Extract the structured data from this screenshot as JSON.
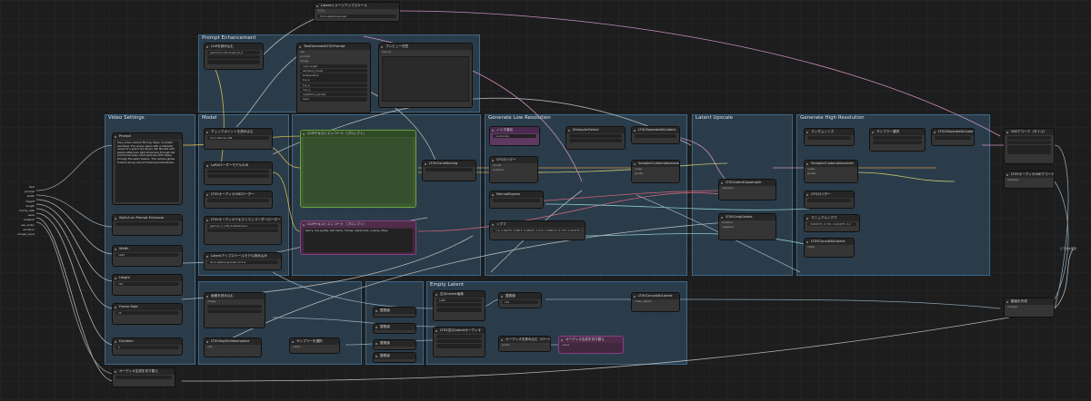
{
  "app": {
    "name": "ComfyUI workflow canvas"
  },
  "groups": [
    {
      "id": "prompt-enh",
      "title": "Prompt Enhancement"
    },
    {
      "id": "video-settings",
      "title": "Video Settings"
    },
    {
      "id": "model",
      "title": "Model"
    },
    {
      "id": "prompt",
      "title": ""
    },
    {
      "id": "gen-low",
      "title": "Generate Low Resolution"
    },
    {
      "id": "latent-upscale",
      "title": "Latent Upscale"
    },
    {
      "id": "gen-high",
      "title": "Generate High Resolution"
    },
    {
      "id": "bottom-left",
      "title": ""
    },
    {
      "id": "bottom-mid",
      "title": ""
    },
    {
      "id": "empty-latent",
      "title": "Empty Latent"
    }
  ],
  "nodes": {
    "latent_top": {
      "title": "Latentイメージアップスケール",
      "rows": [
        "モデル",
        "アップスケール"
      ],
      "widget": "ltx-2-spatial-upscaler"
    },
    "load_llm": {
      "title": "LLMを読み込む",
      "widget": "gemma-3-12b-it-qat-q4_0"
    },
    "enh_gen": {
      "title": "TextGenerateLTX2Prompt",
      "rows": [
        "clip",
        "prompt",
        "image",
        "max_length",
        "sampling_mode",
        "temperature",
        "top_k",
        "top_p",
        "min_p",
        "repetition_penalty",
        "seed"
      ]
    },
    "preview_text": {
      "title": "プレビュー任意",
      "rows": [
        "source"
      ]
    },
    "prompt": {
      "title": "Prompt",
      "text": "Sony video camera filming, Style: cinematic handheld. The scene opens with a dramatic reveal of a grand old library hall flooded with golden afternoon light streaming through tall arched windows. Dust particles drift slowly through the warm beams. The camera glides forward along rows of towering bookshelves."
    },
    "enhancer_toggle": {
      "title": "Switch on Prompt Enhancer"
    },
    "width": {
      "title": "Width",
      "value": "1280"
    },
    "height": {
      "title": "Height",
      "value": "720"
    },
    "frame_rate": {
      "title": "Frame Rate",
      "value": "25"
    },
    "duration": {
      "title": "Duration",
      "value": "5"
    },
    "checkpoint_loader": {
      "title": "チェックポイントを読み込む",
      "widget": "ltx-2-19b-dev-fp8"
    },
    "lora_loader": {
      "title": "LoRAローダーモデルのみ"
    },
    "lora_loader2": {
      "title": "LTXVオーディオVAEローダー"
    },
    "text_encoder": {
      "title": "LTXVオーディオテキストエンコーダーローダー",
      "widget": "gemma_3_12B_it.safetensors"
    },
    "latent_up2": {
      "title": "Latentアップスケールモデル読み込み",
      "widget": "ltx-2-spatial-upscaler-x2-1.0"
    },
    "clip_pos": {
      "title": "CLIPテキストエンコード（プロンプト）"
    },
    "clip_neg": {
      "title": "CLIPテキストエンコード（プロンプト）",
      "text": "blurry, low quality, still frame, frames, watermark, overlay, titles"
    },
    "ltxv_cond": {
      "title": "LTXVConditioning"
    },
    "mgr": {
      "title": "モデル"
    },
    "low_noise": {
      "title": "ノイズ追加",
      "widget": "randomize"
    },
    "low_sampler": {
      "title": "KSamplerSelect"
    },
    "low_cfg": {
      "title": "CFGガイダー"
    },
    "low_sched": {
      "title": "ManualSigmas"
    },
    "low_sigmas": {
      "title": "シグマ",
      "widget": "1.0, 0.99375, 0.9875, 0.98125, 0.975, 0.909375, 0.725, 0.421875, 0.0"
    },
    "low_adv": {
      "title": "SamplerCustomAdvanced"
    },
    "low_sep": {
      "title": "LTXVSeparateAVLatent"
    },
    "low_cat": {
      "title": "LTXVConcatAVLatent"
    },
    "up_node": {
      "title": "LTXVLatentUpsampler"
    },
    "up_crop": {
      "title": "LTXVCropGuides"
    },
    "hi_noise": {
      "title": "ランダムノイズ"
    },
    "hi_sampler": {
      "title": "サンプラー選択"
    },
    "hi_sigmas": {
      "title": "マニュアルシグマ",
      "widget": "0.909375, 0.725, 0.421875, 0.0"
    },
    "hi_adv": {
      "title": "SamplerCustomAdvanced"
    },
    "hi_sep": {
      "title": "LTXVSeparateAVLatent"
    },
    "hi_vae": {
      "title": "VAEデコード（タイル）"
    },
    "audio_vae": {
      "title": "LTXVオーディオVAEデコード"
    },
    "create_video": {
      "title": "動画を作成"
    },
    "empty_img": {
      "title": "空のLatent画像",
      "widget": "1280"
    },
    "empty_audio": {
      "title": "LTXV空のLatentオーディオ"
    },
    "concat_av": {
      "title": "LTXVConcatAVLatent"
    },
    "img_to_video": {
      "title": "LTXVImgToVideoInplace"
    },
    "set_node": {
      "title": "サンプラーを選択"
    },
    "math": {
      "title": "整数値",
      "widget": "121"
    },
    "load_audio": {
      "title": "オーディオを読み込む（ロード）"
    },
    "save_video": {
      "title": "ビデオを保存"
    },
    "bottom_toggle": {
      "title": "オーディオ生成を切り替え"
    },
    "image_in": {
      "title": "画像を読み込む",
      "rows": [
        "image"
      ]
    }
  },
  "primitive_inputs": [
    "text",
    "prompt",
    "width",
    "height",
    "length",
    "frame_rate",
    "seed",
    "enabled",
    "use_audio",
    "duration",
    "image_input"
  ],
  "colors": {
    "accent_green": "#69a23a",
    "accent_purple": "#8a3f86",
    "group_blue": "#345670"
  }
}
